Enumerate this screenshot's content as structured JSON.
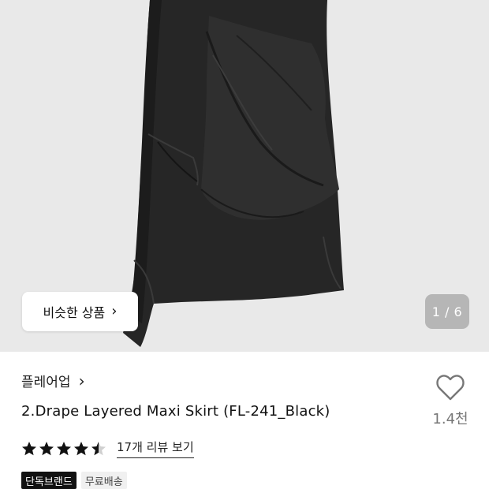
{
  "gallery": {
    "similar_button_label": "비슷한 상품",
    "counter": "1 / 6"
  },
  "product": {
    "brand": "플레어업",
    "title": "2.Drape Layered Maxi Skirt (FL-241_Black)",
    "likes": "1.4천",
    "rating": 4.5,
    "review_link": "17개 리뷰 보기",
    "badges": [
      "단독브랜드",
      "무료배송"
    ]
  },
  "icons": {
    "brand_chevron": "chevron-right-icon",
    "like": "heart-outline-icon",
    "star": "star-icon"
  },
  "colors": {
    "hero_bg": "#e9e9e9",
    "skirt": "#262626",
    "badge_dark": "#111111"
  }
}
